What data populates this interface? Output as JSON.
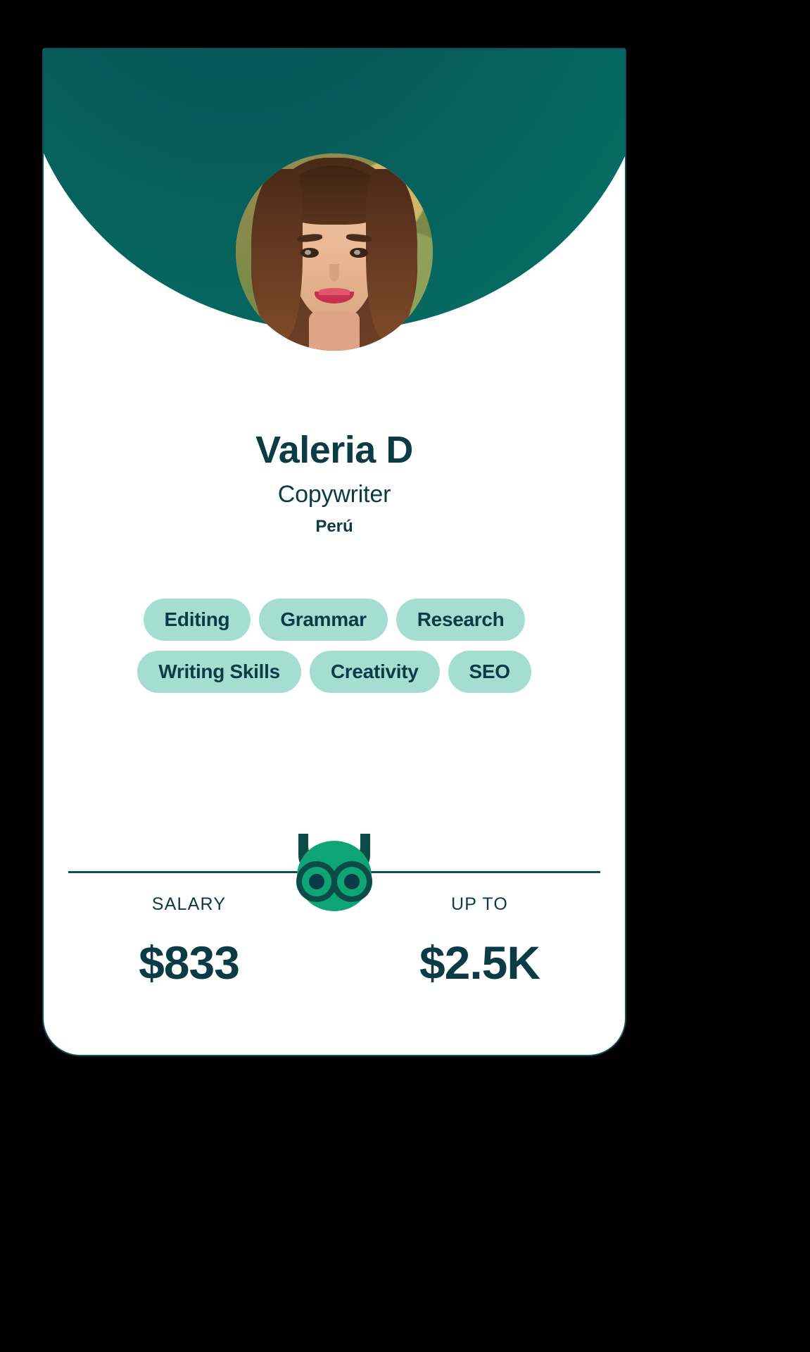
{
  "theme": {
    "page_background": "#000000",
    "card_background": "#ffffff",
    "header_teal": "#075d5a",
    "ink": "#0b3b44",
    "pill_background": "#a5ded1",
    "owl_green": "#0fa476",
    "owl_dark": "#0b4b48",
    "divider": "#0e4f5a"
  },
  "profile": {
    "avatar": "profile-photo",
    "name": "Valeria D",
    "role": "Copywriter",
    "location": "Perú"
  },
  "skills": [
    {
      "label": "Editing"
    },
    {
      "label": "Grammar"
    },
    {
      "label": "Research"
    },
    {
      "label": "Writing Skills"
    },
    {
      "label": "Creativity"
    },
    {
      "label": "SEO"
    }
  ],
  "brand": {
    "logo": "owl-logo"
  },
  "compensation": [
    {
      "label": "SALARY",
      "value": "$833"
    },
    {
      "label": "UP TO",
      "value": "$2.5K"
    }
  ]
}
